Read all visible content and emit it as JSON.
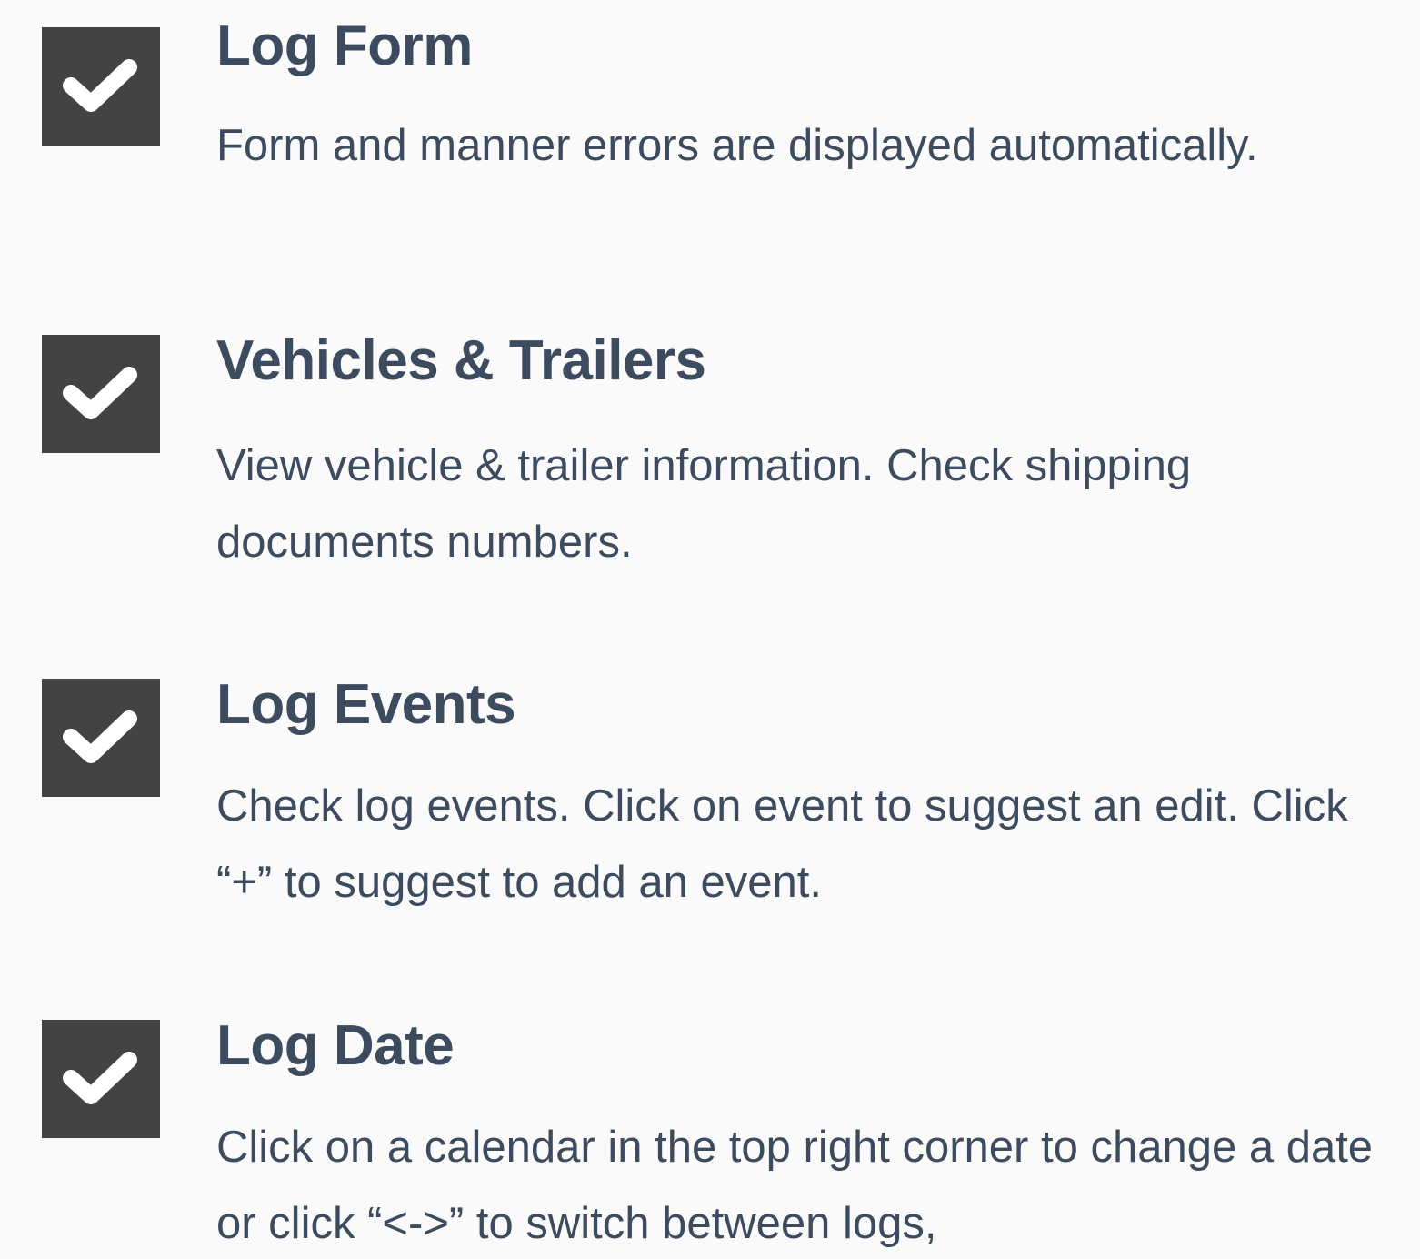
{
  "colors": {
    "background": "#fafafa",
    "checkbox": "#434343",
    "check_mark": "#ffffff",
    "text": "#3d4b5f"
  },
  "features": [
    {
      "icon": "checkmark-icon",
      "title": "Log Form",
      "description": "Form and manner errors are displayed automatically."
    },
    {
      "icon": "checkmark-icon",
      "title": "Vehicles & Trailers",
      "description": "View vehicle & trailer information. Check shipping documents numbers."
    },
    {
      "icon": "checkmark-icon",
      "title": "Log Events",
      "description": "Check log events. Click on event to suggest an edit. Click “+” to suggest to add an event."
    },
    {
      "icon": "checkmark-icon",
      "title": "Log Date",
      "description": "Click on a calendar in the top right corner to change a date or click “<->” to switch between logs,"
    }
  ]
}
